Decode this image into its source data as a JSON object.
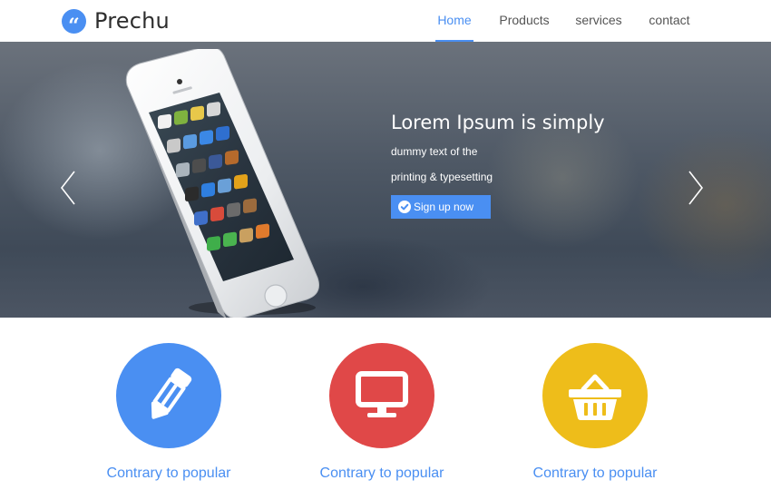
{
  "brand": {
    "mark": "“",
    "name": "Prechu",
    "logo_icon": "quote-icon",
    "color": "#4a8ff2"
  },
  "nav": {
    "items": [
      {
        "label": "Home",
        "active": true
      },
      {
        "label": "Products",
        "active": false
      },
      {
        "label": "services",
        "active": false
      },
      {
        "label": "contact",
        "active": false
      }
    ],
    "accent": "#4a8ff2"
  },
  "hero": {
    "title": "Lorem Ipsum is simply",
    "line1": "dummy text of the",
    "line2": "printing & typesetting",
    "button_label": "Sign up now",
    "button_icon": "check-circle-icon",
    "prev_icon": "chevron-left-icon",
    "next_icon": "chevron-right-icon",
    "image": "smartphone-image"
  },
  "features": [
    {
      "label": "Contrary to popular",
      "icon": "pencil-icon",
      "color": "#4a8ff2"
    },
    {
      "label": "Contrary to popular",
      "icon": "monitor-icon",
      "color": "#e04848"
    },
    {
      "label": "Contrary to popular",
      "icon": "basket-icon",
      "color": "#eebd1a"
    }
  ]
}
